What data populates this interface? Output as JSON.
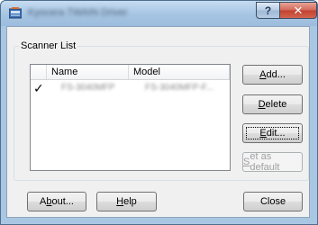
{
  "window": {
    "title": "Kyocera TWAIN Driver",
    "help_glyph": "?",
    "close_glyph": "✕"
  },
  "scanner_list": {
    "legend": "Scanner List",
    "columns": [
      "Name",
      "Model"
    ],
    "rows": [
      {
        "checked": true,
        "check_glyph": "✓",
        "name": "FS-3040MFP",
        "model": "FS-3040MFP-F..."
      }
    ]
  },
  "buttons": {
    "add": {
      "mnemonic": "A",
      "rest": "dd..."
    },
    "delete": {
      "mnemonic": "D",
      "rest": "elete"
    },
    "edit": {
      "mnemonic": "E",
      "rest": "dit..."
    },
    "set_default": {
      "mnemonic": "S",
      "rest": "et as default",
      "enabled": false
    },
    "about": {
      "pre": "A",
      "mnemonic": "b",
      "rest": "out..."
    },
    "help": {
      "mnemonic": "H",
      "rest": "elp"
    },
    "close": {
      "label": "Close"
    }
  },
  "colors": {
    "frame": "#a9c6e2",
    "dialog_bg": "#f0f0f0",
    "close_button": "#c1412f"
  },
  "icons": [
    "app-icon",
    "help-icon",
    "close-icon",
    "check-icon"
  ]
}
